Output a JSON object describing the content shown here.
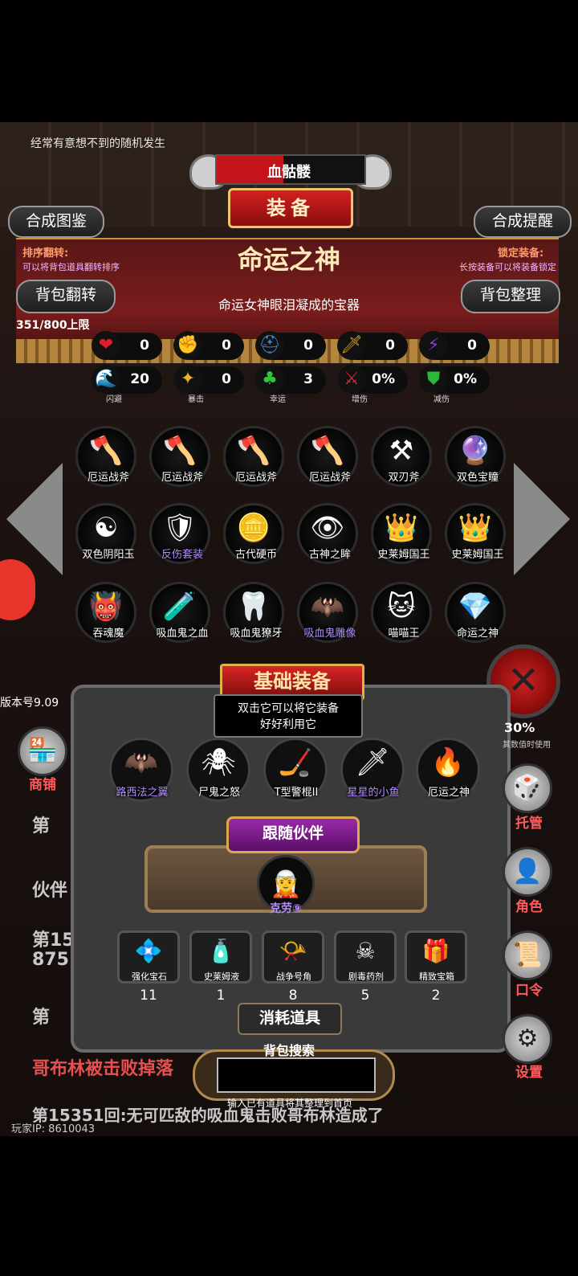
{
  "header": {
    "hint": "经常有意想不到的随机发生",
    "boss_name": "血骷髅",
    "boss_hp_fraction": 0.45,
    "title": "装备"
  },
  "buttons": {
    "compose_catalog": "合成图鉴",
    "compose_reminder": "合成提醒",
    "bag_flip": "背包翻转",
    "bag_sort": "背包整理"
  },
  "hints": {
    "sort_flip_title": "排序翻转:",
    "sort_flip_desc": "可以将背包道具翻转排序",
    "lock_title": "锁定装备:",
    "lock_desc": "长按装备可以将装备锁定"
  },
  "selected_item": {
    "name": "命运之神",
    "description": "命运女神眼泪凝成的宝器"
  },
  "capacity": "351/800上限",
  "stats_row1": [
    {
      "icon": "heart-icon",
      "glyph": "❤",
      "color": "#d8202a",
      "value": "0",
      "caption": ""
    },
    {
      "icon": "strength-icon",
      "glyph": "✊",
      "color": "#e6c22a",
      "value": "0",
      "caption": ""
    },
    {
      "icon": "helmet-icon",
      "glyph": "⛑",
      "color": "#3a8bd8",
      "value": "0",
      "caption": ""
    },
    {
      "icon": "sword-icon",
      "glyph": "🗡",
      "color": "#d8a22a",
      "value": "0",
      "caption": ""
    },
    {
      "icon": "lightning-icon",
      "glyph": "⚡",
      "color": "#8a3ad8",
      "value": "0",
      "caption": ""
    }
  ],
  "stats_row2": [
    {
      "icon": "dodge-icon",
      "glyph": "🌊",
      "color": "#2a8ae8",
      "value": "20",
      "caption": "闪避"
    },
    {
      "icon": "crit-icon",
      "glyph": "✦",
      "color": "#e8b22a",
      "value": "0",
      "caption": "暴击"
    },
    {
      "icon": "clover-icon",
      "glyph": "♣",
      "color": "#2ac83a",
      "value": "3",
      "caption": "幸运"
    },
    {
      "icon": "damage-up-icon",
      "glyph": "⚔",
      "color": "#e8282a",
      "value": "0%",
      "caption": "增伤"
    },
    {
      "icon": "shield-icon",
      "glyph": "⛊",
      "color": "#2ab83a",
      "value": "0%",
      "caption": "减伤"
    }
  ],
  "inventory": [
    {
      "label": "厄运战斧",
      "glyph": "🪓",
      "label_color": "#ffffff"
    },
    {
      "label": "厄运战斧",
      "glyph": "🪓",
      "label_color": "#ffffff"
    },
    {
      "label": "厄运战斧",
      "glyph": "🪓",
      "label_color": "#ffffff"
    },
    {
      "label": "厄运战斧",
      "glyph": "🪓",
      "label_color": "#ffffff"
    },
    {
      "label": "双刃斧",
      "glyph": "⚒",
      "label_color": "#ffffff"
    },
    {
      "label": "双色宝瞳",
      "glyph": "🔮",
      "label_color": "#ffffff"
    },
    {
      "label": "双色阴阳玉",
      "glyph": "☯",
      "label_color": "#ffffff"
    },
    {
      "label": "反伤套装",
      "glyph": "🛡",
      "label_color": "#b48cff"
    },
    {
      "label": "古代硬币",
      "glyph": "🪙",
      "label_color": "#ffffff"
    },
    {
      "label": "古神之眸",
      "glyph": "👁",
      "label_color": "#ffffff"
    },
    {
      "label": "史莱姆国王",
      "glyph": "👑",
      "label_color": "#ffffff"
    },
    {
      "label": "史莱姆国王",
      "glyph": "👑",
      "label_color": "#ffffff"
    },
    {
      "label": "吞魂魔",
      "glyph": "👹",
      "label_color": "#ffffff"
    },
    {
      "label": "吸血鬼之血",
      "glyph": "🧪",
      "label_color": "#ffffff"
    },
    {
      "label": "吸血鬼獠牙",
      "glyph": "🦷",
      "label_color": "#ffffff"
    },
    {
      "label": "吸血鬼雕像",
      "glyph": "🦇",
      "label_color": "#b48cff"
    },
    {
      "label": "喵喵王",
      "glyph": "🐱",
      "label_color": "#ffffff"
    },
    {
      "label": "命运之神",
      "glyph": "💎",
      "label_color": "#ffffff"
    }
  ],
  "version": "版本号9.09",
  "basic_equipment": {
    "title": "基础装备",
    "tooltip_line1": "双击它可以将它装备",
    "tooltip_line2": "好好利用它",
    "slots": [
      {
        "label": "路西法之翼",
        "glyph": "🦇",
        "label_color": "#b48cff"
      },
      {
        "label": "尸鬼之怒",
        "glyph": "🕷",
        "label_color": "#ffffff"
      },
      {
        "label": "T型警棍II",
        "glyph": "🏒",
        "label_color": "#ffffff"
      },
      {
        "label": "星星的小鱼",
        "glyph": "🗡",
        "label_color": "#b48cff"
      },
      {
        "label": "厄运之神",
        "glyph": "🔥",
        "label_color": "#ffffff"
      }
    ]
  },
  "companion": {
    "button": "跟随伙伴",
    "name": "克劳⑨"
  },
  "consumables": {
    "title": "消耗道具",
    "items": [
      {
        "name": "强化宝石",
        "glyph": "💠",
        "count": "11"
      },
      {
        "name": "史莱姆液",
        "glyph": "🧴",
        "count": "1"
      },
      {
        "name": "战争号角",
        "glyph": "📯",
        "count": "8"
      },
      {
        "name": "剧毒药剂",
        "glyph": "☠",
        "count": "5"
      },
      {
        "name": "精致宝箱",
        "glyph": "🎁",
        "count": "2"
      }
    ]
  },
  "search": {
    "title": "背包搜索",
    "value": "",
    "hint": "输入已有道具将其整理到首页"
  },
  "log": {
    "line1": "第",
    "line2": "伙伴",
    "line3a": "第15",
    "line3b": "875",
    "line4": "第",
    "line5": "哥布林被击败掉落",
    "line6": "第15351回:无可匹敌的吸血鬼击败哥布林造成了",
    "rate": "30%",
    "rate_desc": "其数值时使用",
    "player_ip": "玩家IP: 8610043"
  },
  "side_menu": {
    "shop": "商铺",
    "manage": "托管",
    "role": "角色",
    "password": "口令",
    "settings": "设置"
  }
}
